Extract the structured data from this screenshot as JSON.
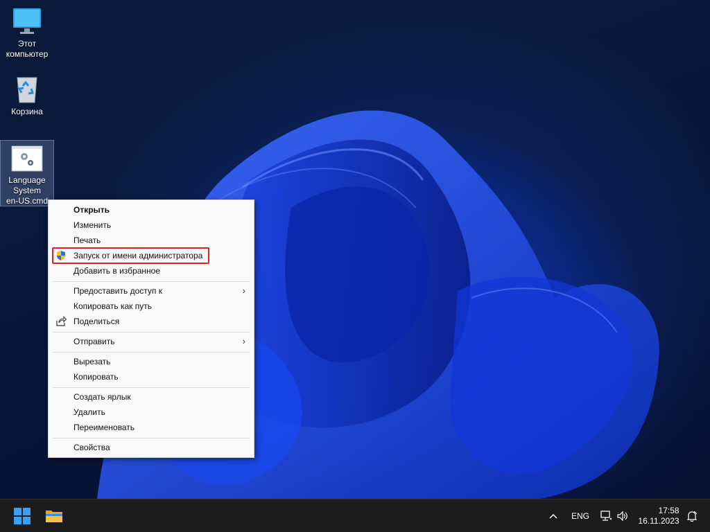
{
  "desktop": {
    "icons": [
      {
        "name": "this-pc",
        "label": "Этот\nкомпьютер"
      },
      {
        "name": "recycle-bin",
        "label": "Корзина"
      },
      {
        "name": "script-file",
        "label": "Language\nSystem\nen-US.cmd"
      }
    ]
  },
  "context_menu": {
    "open": "Открыть",
    "edit": "Изменить",
    "print": "Печать",
    "run_as_admin": "Запуск от имени администратора",
    "add_favorites": "Добавить в избранное",
    "give_access": "Предоставить доступ к",
    "copy_as_path": "Копировать как путь",
    "share": "Поделиться",
    "send_to": "Отправить",
    "cut": "Вырезать",
    "copy": "Копировать",
    "create_shortcut": "Создать ярлык",
    "delete": "Удалить",
    "rename": "Переименовать",
    "properties": "Свойства",
    "submenu_arrow": "›"
  },
  "taskbar": {
    "overflow_chevron": "^",
    "language": "ENG",
    "time": "17:58",
    "date": "16.11.2023"
  },
  "colors": {
    "highlight": "#e01f1f",
    "start_blue": "#3aa0f3",
    "folder_yellow": "#f5c242"
  }
}
